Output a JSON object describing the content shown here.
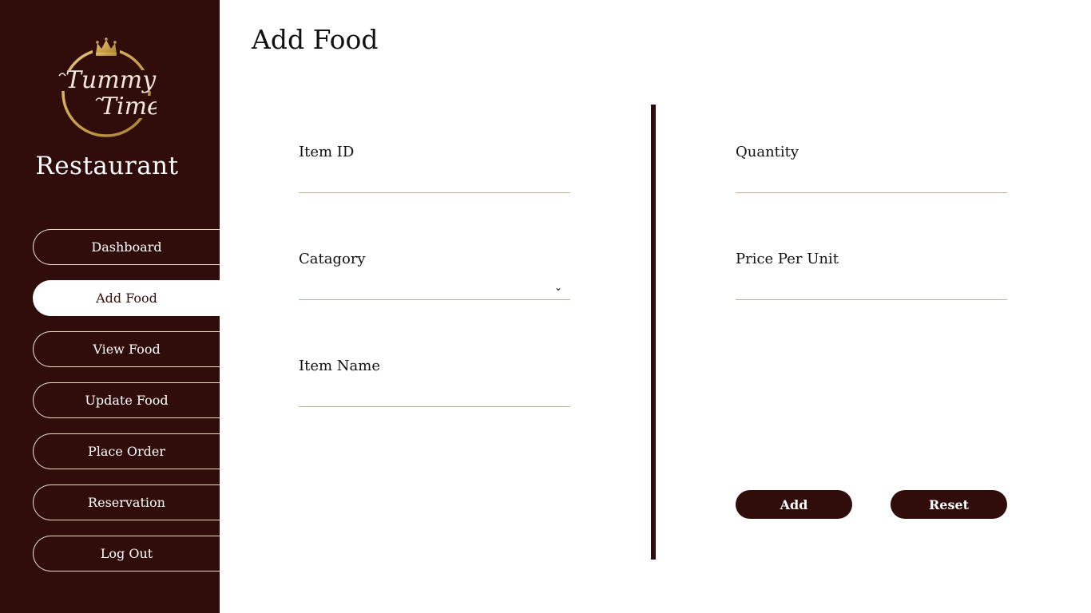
{
  "sidebar": {
    "logo": {
      "line1": "Tummy",
      "line2": "Time",
      "color": "#c8a04e"
    },
    "brand_name": "Restaurant",
    "items": [
      {
        "label": "Dashboard"
      },
      {
        "label": "Add Food"
      },
      {
        "label": "View Food"
      },
      {
        "label": "Update Food"
      },
      {
        "label": "Place Order"
      },
      {
        "label": "Reservation"
      },
      {
        "label": "Log Out"
      }
    ],
    "active_item": "Add Food"
  },
  "main": {
    "title": "Add Food",
    "left_fields": {
      "item_id": {
        "label": "Item ID",
        "value": ""
      },
      "category": {
        "label": "Catagory",
        "value": ""
      },
      "item_name": {
        "label": "Item Name",
        "value": ""
      }
    },
    "right_fields": {
      "quantity": {
        "label": "Quantity",
        "value": ""
      },
      "price_per_unit": {
        "label": "Price Per Unit",
        "value": ""
      }
    },
    "buttons": {
      "add": "Add",
      "reset": "Reset"
    }
  },
  "colors": {
    "sidebar_bg": "#300d0b",
    "accent_gold": "#c8a04e",
    "input_underline": "#c9a98f"
  },
  "icons": [
    "crown-icon",
    "chevron-down-icon"
  ]
}
